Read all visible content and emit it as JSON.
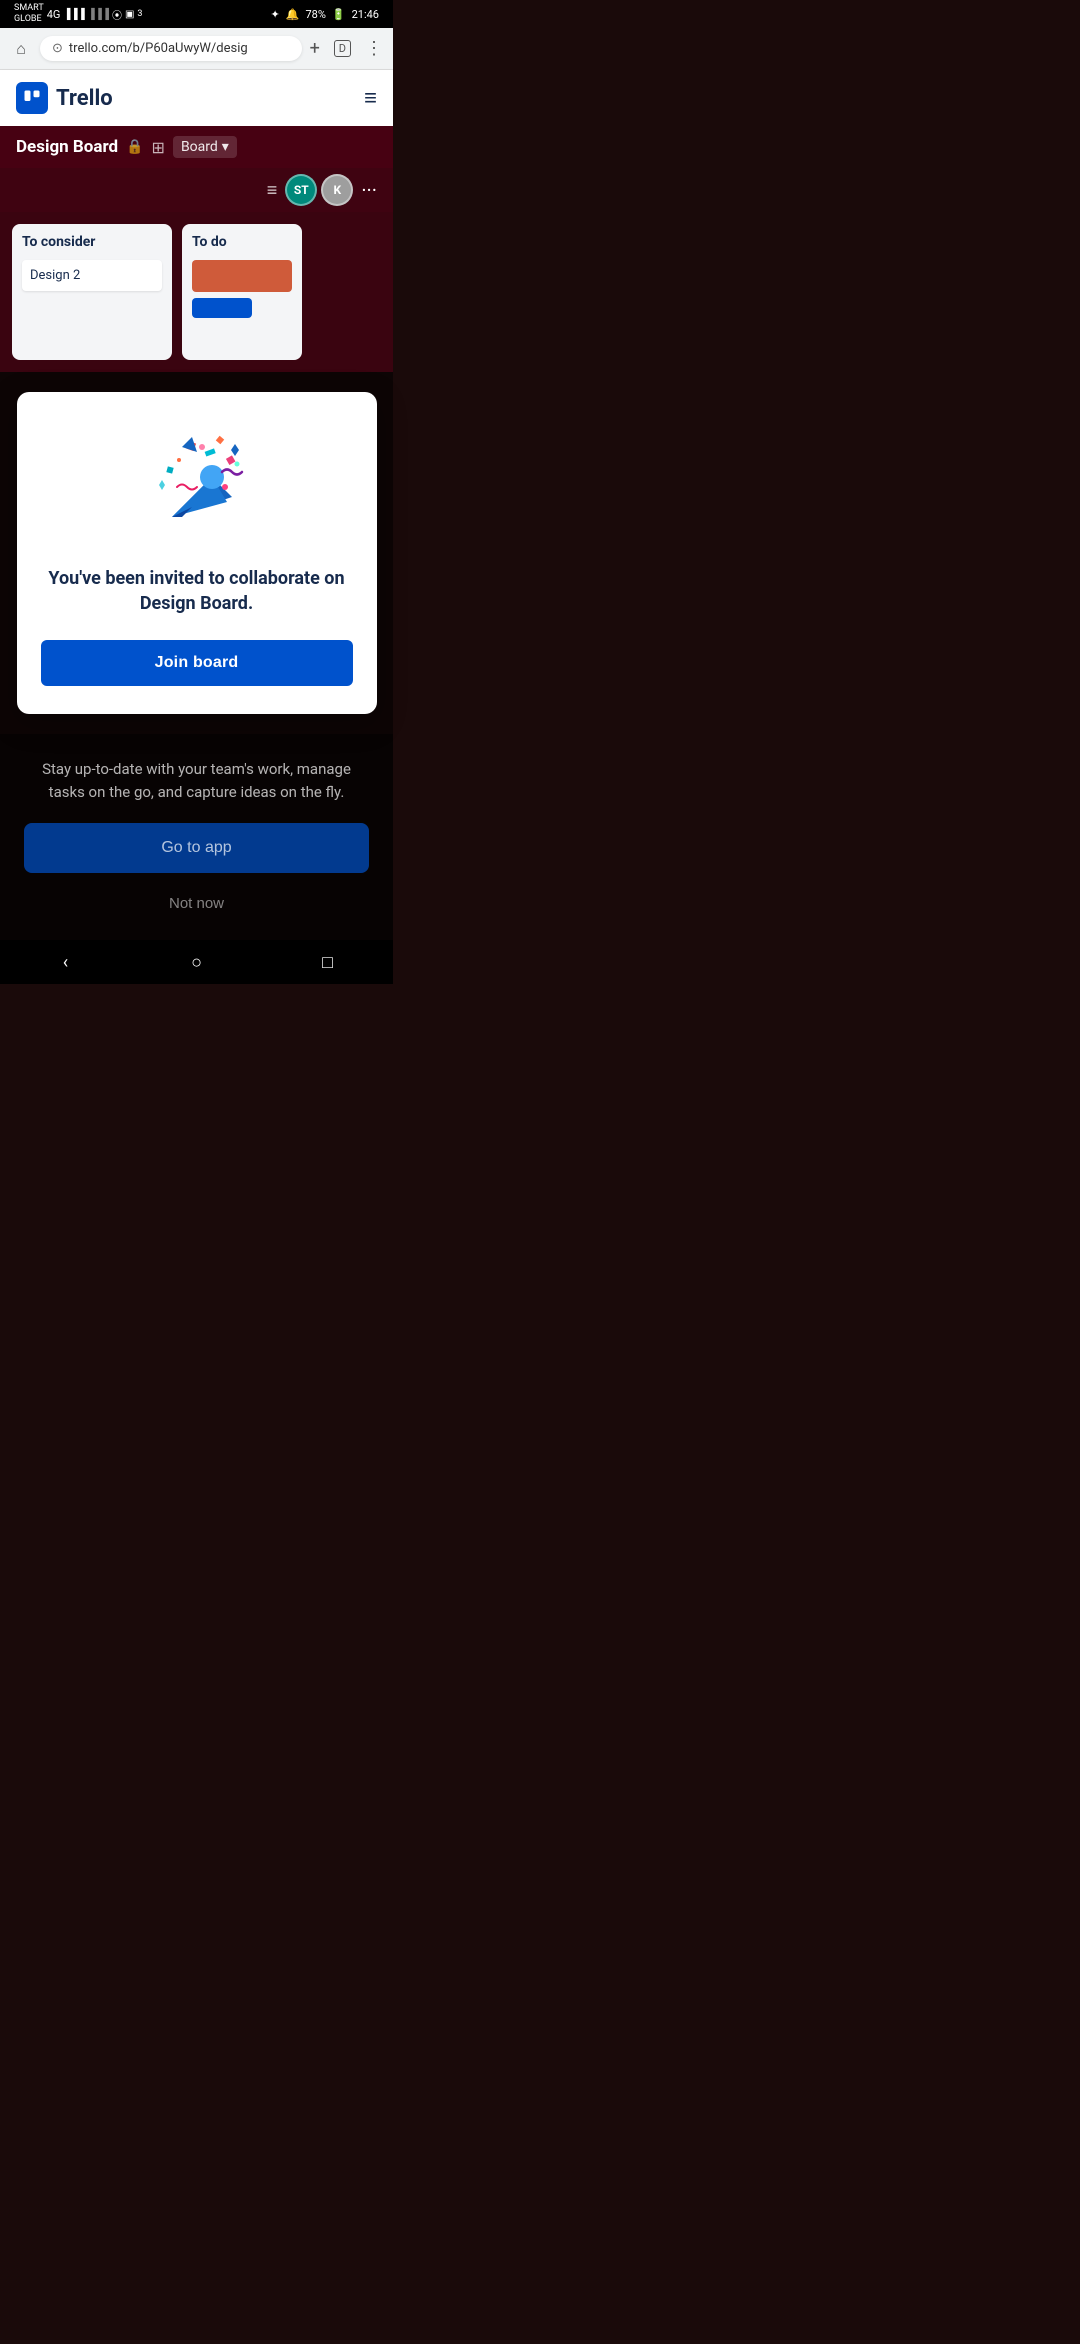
{
  "statusBar": {
    "carrier": "SMART",
    "network": "4G",
    "globe": "GLOBE",
    "time": "21:46",
    "battery": "78%",
    "bluetooth": "⚡"
  },
  "browser": {
    "url": "trello.com/b/P60aUwyW/desig",
    "tabCount": "D"
  },
  "trello": {
    "logo_text": "Trello"
  },
  "board": {
    "title": "Design Board",
    "viewLabel": "Board",
    "member1": "ST",
    "member2": "K",
    "lists": [
      {
        "title": "To consider",
        "cards": [
          "Design 2"
        ]
      },
      {
        "title": "To do",
        "cards": []
      }
    ]
  },
  "modal": {
    "invite_text": "You've been invited to collaborate on Design Board.",
    "join_button": "Join board"
  },
  "appSection": {
    "description": "Stay up-to-date with your team's work, manage tasks on the go, and capture ideas on the fly.",
    "go_to_app": "Go to app",
    "not_now": "Not now"
  },
  "androidNav": {
    "back": "‹",
    "home": "○",
    "recent": "□"
  }
}
